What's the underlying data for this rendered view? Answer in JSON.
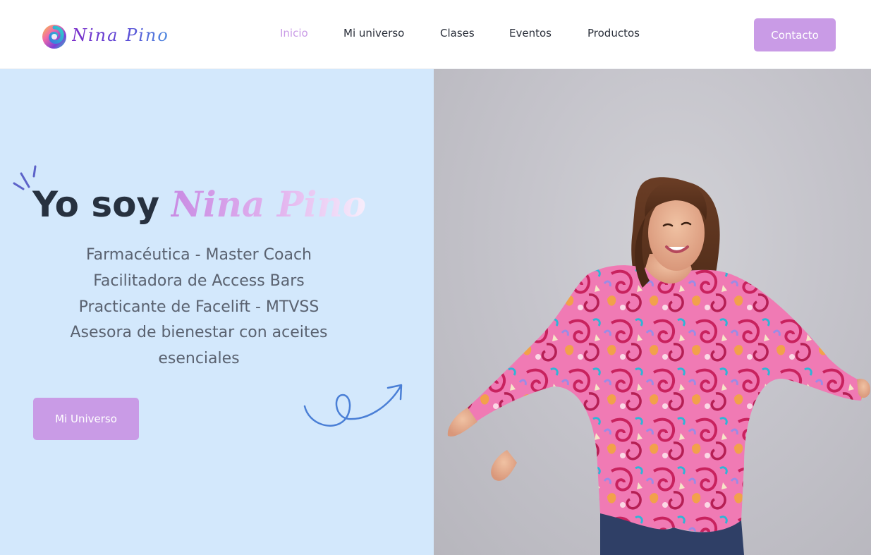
{
  "header": {
    "logo_text": "Nina Pino",
    "nav": [
      {
        "label": "Inicio",
        "active": true
      },
      {
        "label": "Mi universo",
        "active": false
      },
      {
        "label": "Clases",
        "active": false
      },
      {
        "label": "Eventos",
        "active": false
      },
      {
        "label": "Productos",
        "active": false
      }
    ],
    "contact_label": "Contacto"
  },
  "hero": {
    "title_lead": "Yo soy",
    "title_name": "Nina Pino",
    "roles": [
      "Farmacéutica - Master Coach",
      "Facilitadora de Access Bars",
      "Practicante de Facelift - MTVSS",
      "Asesora de bienestar con aceites esenciales"
    ],
    "cta_label": "Mi Universo"
  },
  "icons": {
    "logo": "swirl-logo-icon",
    "sparkle": "sparkle-lines-icon",
    "arrow": "curly-arrow-icon"
  },
  "colors": {
    "accent": "#c99be6",
    "hero_bg": "#d3e8fc",
    "text_dark": "#27313f",
    "doodle_blue": "#4a7fd6"
  }
}
